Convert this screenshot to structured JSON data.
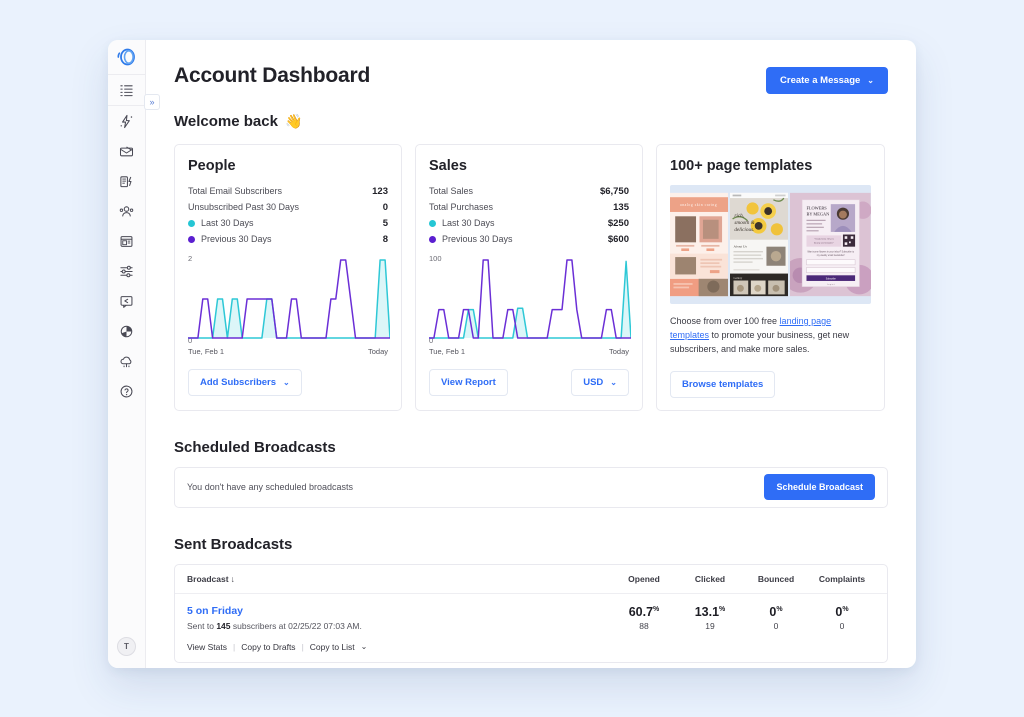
{
  "theme": {
    "page_bg": "#eaf2fd",
    "accent": "#2f6df6",
    "teal": "#25c6d4",
    "purple": "#5b1fd0"
  },
  "sidebar": {
    "logo_name": "convertkit-logo",
    "collapse_label": "»",
    "items": [
      {
        "icon": "list-icon",
        "name": "sidebar-item-tasks"
      },
      {
        "icon": "lightning-icon",
        "name": "sidebar-item-automations"
      },
      {
        "icon": "envelope-icon",
        "name": "sidebar-item-email"
      },
      {
        "icon": "broadcast-icon",
        "name": "sidebar-item-broadcasts"
      },
      {
        "icon": "people-icon",
        "name": "sidebar-item-subscribers"
      },
      {
        "icon": "landing-page-icon",
        "name": "sidebar-item-landing-pages"
      },
      {
        "icon": "sliders-icon",
        "name": "sidebar-item-settings"
      },
      {
        "icon": "comment-icon",
        "name": "sidebar-item-messages"
      },
      {
        "icon": "pie-chart-icon",
        "name": "sidebar-item-reports"
      },
      {
        "icon": "cloud-icon",
        "name": "sidebar-item-integrations"
      },
      {
        "icon": "help-icon",
        "name": "sidebar-item-help"
      }
    ],
    "avatar_initial": "T"
  },
  "header": {
    "title": "Account Dashboard",
    "create_message_label": "Create a Message",
    "create_message_caret": "⌄"
  },
  "welcome": {
    "text": "Welcome back",
    "emoji": "👋"
  },
  "people_card": {
    "title": "People",
    "stats": [
      {
        "label": "Total Email Subscribers",
        "value": "123",
        "dot": ""
      },
      {
        "label": "Unsubscribed Past 30 Days",
        "value": "0",
        "dot": ""
      },
      {
        "label": "Last 30 Days",
        "value": "5",
        "dot": "teal"
      },
      {
        "label": "Previous 30 Days",
        "value": "8",
        "dot": "purple"
      }
    ],
    "button_label": "Add Subscribers",
    "button_caret": "⌄"
  },
  "sales_card": {
    "title": "Sales",
    "stats": [
      {
        "label": "Total Sales",
        "value": "$6,750",
        "dot": ""
      },
      {
        "label": "Total Purchases",
        "value": "135",
        "dot": ""
      },
      {
        "label": "Last 30 Days",
        "value": "$250",
        "dot": "teal"
      },
      {
        "label": "Previous 30 Days",
        "value": "$600",
        "dot": "purple"
      }
    ],
    "button_label": "View Report",
    "currency_label": "USD",
    "currency_caret": "⌄"
  },
  "templates_card": {
    "title": "100+ page templates",
    "copy_before": "Choose from over 100 free ",
    "link_text": "landing page templates",
    "copy_after": " to promote your business, get new subscribers, and make more sales.",
    "button_label": "Browse templates",
    "thumbnails": [
      {
        "name": "template-thumb-beauty",
        "caption": "analog skin caring"
      },
      {
        "name": "template-thumb-food",
        "caption": "rich, smooth & delicious."
      },
      {
        "name": "template-thumb-florist",
        "caption": "FLOWERS BY MEGAN"
      }
    ]
  },
  "scheduled": {
    "section_title": "Scheduled Broadcasts",
    "empty_text": "You don't have any scheduled broadcasts",
    "button_label": "Schedule Broadcast"
  },
  "sent": {
    "section_title": "Sent Broadcasts",
    "columns": [
      "Broadcast",
      "Opened",
      "Clicked",
      "Bounced",
      "Complaints"
    ],
    "sort_arrow": "↓",
    "rows": [
      {
        "title": "5 on Friday",
        "sub_prefix": "Sent to ",
        "sub_count": "145",
        "sub_suffix": " subscribers at 02/25/22 07:03 AM.",
        "actions": [
          "View Stats",
          "Copy to Drafts",
          "Copy to List"
        ],
        "actions_caret": "⌄",
        "metrics": [
          {
            "name": "opened",
            "percent": "60.7",
            "unit": "%",
            "count": "88"
          },
          {
            "name": "clicked",
            "percent": "13.1",
            "unit": "%",
            "count": "19"
          },
          {
            "name": "bounced",
            "percent": "0",
            "unit": "%",
            "count": "0"
          },
          {
            "name": "complaints",
            "percent": "0",
            "unit": "%",
            "count": "0"
          }
        ]
      }
    ]
  },
  "chart_data": [
    {
      "type": "line",
      "name": "people-chart",
      "title": "People — subscribers per day",
      "xlabel": "",
      "ylabel": "",
      "xlim": [
        "Tue, Feb 1",
        "Today"
      ],
      "x_tick_labels": [
        "Tue, Feb 1",
        "Today"
      ],
      "y_tick_labels": [
        "0",
        "2"
      ],
      "ylim": [
        0,
        2
      ],
      "grid": false,
      "legend": "inline-stats",
      "series": [
        {
          "name": "Previous 30 Days",
          "color": "#6b2fd6",
          "values": [
            0,
            0,
            0,
            1,
            1,
            0,
            0,
            0,
            0,
            0,
            0,
            0,
            1,
            1,
            1,
            1,
            1,
            1,
            0,
            0,
            0,
            1,
            1,
            0,
            0,
            0,
            0,
            0,
            0,
            1,
            1,
            2,
            2,
            1,
            0,
            0,
            0,
            0,
            0,
            0,
            0,
            0
          ]
        },
        {
          "name": "Last 30 Days",
          "color": "#2ec8d6",
          "values": [
            0,
            0,
            0,
            0,
            0,
            0,
            1,
            1,
            0,
            1,
            1,
            0,
            0,
            0,
            0,
            0,
            1,
            1,
            0,
            0,
            0,
            0,
            0,
            0,
            0,
            0,
            0,
            0,
            0,
            0,
            0,
            0,
            0,
            0,
            0,
            0,
            0,
            0,
            0,
            2,
            2,
            0
          ]
        }
      ]
    },
    {
      "type": "line",
      "name": "sales-chart",
      "title": "Sales — revenue per day",
      "xlabel": "",
      "ylabel": "",
      "xlim": [
        "Tue, Feb 1",
        "Today"
      ],
      "x_tick_labels": [
        "Tue, Feb 1",
        "Today"
      ],
      "y_tick_labels": [
        "0",
        "100"
      ],
      "ylim": [
        0,
        110
      ],
      "grid": false,
      "legend": "inline-stats",
      "series": [
        {
          "name": "Previous 30 Days",
          "color": "#6b2fd6",
          "values": [
            0,
            0,
            40,
            40,
            0,
            0,
            0,
            40,
            40,
            0,
            0,
            110,
            110,
            0,
            0,
            0,
            40,
            40,
            0,
            0,
            0,
            0,
            0,
            0,
            0,
            40,
            40,
            40,
            110,
            110,
            40,
            0,
            0,
            0,
            0,
            0,
            40,
            40,
            0,
            0,
            0,
            0
          ]
        },
        {
          "name": "Last 30 Days",
          "color": "#2ec8d6",
          "values": [
            0,
            0,
            0,
            0,
            0,
            0,
            0,
            0,
            40,
            40,
            0,
            0,
            0,
            0,
            0,
            0,
            0,
            0,
            42,
            42,
            0,
            0,
            0,
            0,
            0,
            0,
            0,
            0,
            0,
            0,
            0,
            0,
            0,
            0,
            0,
            0,
            0,
            0,
            0,
            0,
            108,
            0
          ]
        }
      ]
    }
  ]
}
